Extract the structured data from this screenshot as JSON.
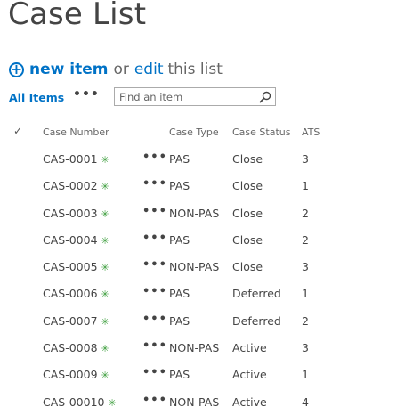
{
  "page": {
    "title": "Case List"
  },
  "actions": {
    "new_item": "new item",
    "or": "or",
    "edit": "edit",
    "this_list": "this list"
  },
  "view": {
    "current": "All Items",
    "more": "•••",
    "search_placeholder": "Find an item"
  },
  "table": {
    "columns": [
      "Case Number",
      "Case Type",
      "Case Status",
      "ATS"
    ],
    "row_menu": "•••",
    "new_marker": "✳",
    "rows": [
      {
        "number": "CAS-0001",
        "type": "PAS",
        "status": "Close",
        "ats": "3"
      },
      {
        "number": "CAS-0002",
        "type": "PAS",
        "status": "Close",
        "ats": "1"
      },
      {
        "number": "CAS-0003",
        "type": "NON-PAS",
        "status": "Close",
        "ats": "2"
      },
      {
        "number": "CAS-0004",
        "type": "PAS",
        "status": "Close",
        "ats": "2"
      },
      {
        "number": "CAS-0005",
        "type": "NON-PAS",
        "status": "Close",
        "ats": "3"
      },
      {
        "number": "CAS-0006",
        "type": "PAS",
        "status": "Deferred",
        "ats": "1"
      },
      {
        "number": "CAS-0007",
        "type": "PAS",
        "status": "Deferred",
        "ats": "2"
      },
      {
        "number": "CAS-0008",
        "type": "NON-PAS",
        "status": "Active",
        "ats": "3"
      },
      {
        "number": "CAS-0009",
        "type": "PAS",
        "status": "Active",
        "ats": "1"
      },
      {
        "number": "CAS-00010",
        "type": "NON-PAS",
        "status": "Active",
        "ats": "4"
      }
    ]
  },
  "colors": {
    "accent": "#0072c6",
    "new_marker": "#3c9e3c",
    "text": "#444444"
  }
}
